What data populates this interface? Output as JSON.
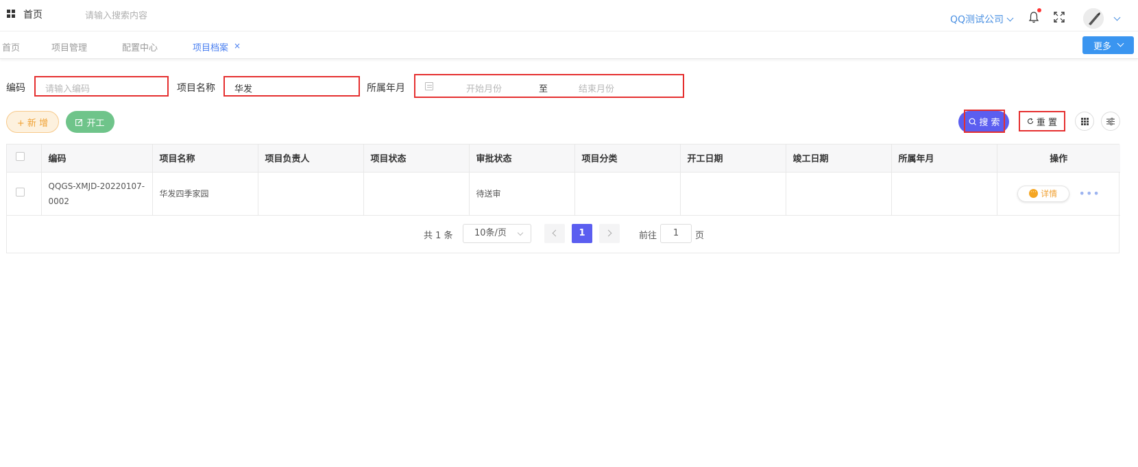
{
  "header": {
    "home_label": "首页",
    "search_placeholder": "请输入搜索内容",
    "company": "QQ测试公司"
  },
  "tabs": [
    {
      "label": "首页",
      "active": false
    },
    {
      "label": "项目管理",
      "active": false
    },
    {
      "label": "配置中心",
      "active": false
    },
    {
      "label": "项目档案",
      "active": true
    }
  ],
  "tab_close": "×",
  "more_label": "更多",
  "filters": {
    "code_label": "编码",
    "code_placeholder": "请输入编码",
    "name_label": "项目名称",
    "name_value": "华发",
    "month_label": "所属年月",
    "start_placeholder": "开始月份",
    "range_sep": "至",
    "end_placeholder": "结束月份"
  },
  "actions": {
    "new_label": "+ 新 增",
    "start_label": "开工",
    "search_label": "搜 索",
    "reset_label": "重 置"
  },
  "table": {
    "columns": [
      "编码",
      "项目名称",
      "项目负责人",
      "项目状态",
      "审批状态",
      "项目分类",
      "开工日期",
      "竣工日期",
      "所属年月",
      "操作"
    ],
    "rows": [
      {
        "code_line1": "QQGS-XMJD-20220107-",
        "code_line2": "0002",
        "name": "华发四季家园",
        "leader": "",
        "status": "",
        "approval": "待送审",
        "category": "",
        "start_date": "",
        "end_date": "",
        "month": "",
        "detail_label": "详情"
      }
    ]
  },
  "pagination": {
    "total": "共 1 条",
    "page_size": "10条/页",
    "current": "1",
    "goto_label": "前往",
    "goto_value": "1",
    "page_suffix": "页"
  },
  "colors": {
    "primary": "#5b5ef0",
    "link": "#4a7ff0",
    "more_button": "#3a95f0",
    "start_button": "#6fc48a",
    "new_button_text": "#f0a235",
    "highlight_border": "#e52e2e"
  }
}
